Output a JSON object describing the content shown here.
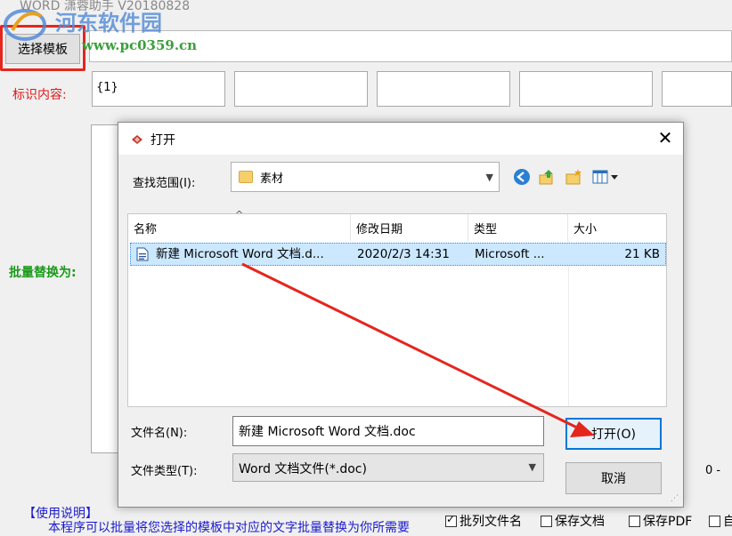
{
  "app": {
    "title": "WORD 潇蓉助手 V20180828",
    "watermark_text": "河东软件园",
    "watermark_url": "www.pc0359.cn",
    "template_button_label": "选择模板",
    "mark_label": "标识内容:",
    "mark_inputs": [
      "{1}",
      "",
      "",
      "",
      ""
    ],
    "batch_label": "批量替换为:",
    "counter": "0 -",
    "usage_title": "【使用说明】",
    "usage_text": "本程序可以批量将您选择的模板中对应的文字批量替换为你所需要",
    "options": [
      {
        "label": "批列文件名",
        "checked": true
      },
      {
        "label": "保存文档",
        "checked": false
      },
      {
        "label": "保存PDF",
        "checked": false
      },
      {
        "label": "自",
        "checked": false
      }
    ]
  },
  "dialog": {
    "title": "打开",
    "lookin_label": "查找范围(I):",
    "lookin_value": "素材",
    "columns": [
      "名称",
      "修改日期",
      "类型",
      "大小"
    ],
    "files": [
      {
        "name": "新建 Microsoft Word 文档.d...",
        "modified": "2020/2/3 14:31",
        "type": "Microsoft ...",
        "size": "21 KB"
      }
    ],
    "filename_label": "文件名(N):",
    "filename_value": "新建 Microsoft Word 文档.doc",
    "filetype_label": "文件类型(T):",
    "filetype_value": "Word 文档文件(*.doc)",
    "open_label": "打开(O)",
    "cancel_label": "取消"
  },
  "colors": {
    "annotation": "#e5261d",
    "selection": "#cce8ff",
    "accent": "#0078d7"
  }
}
